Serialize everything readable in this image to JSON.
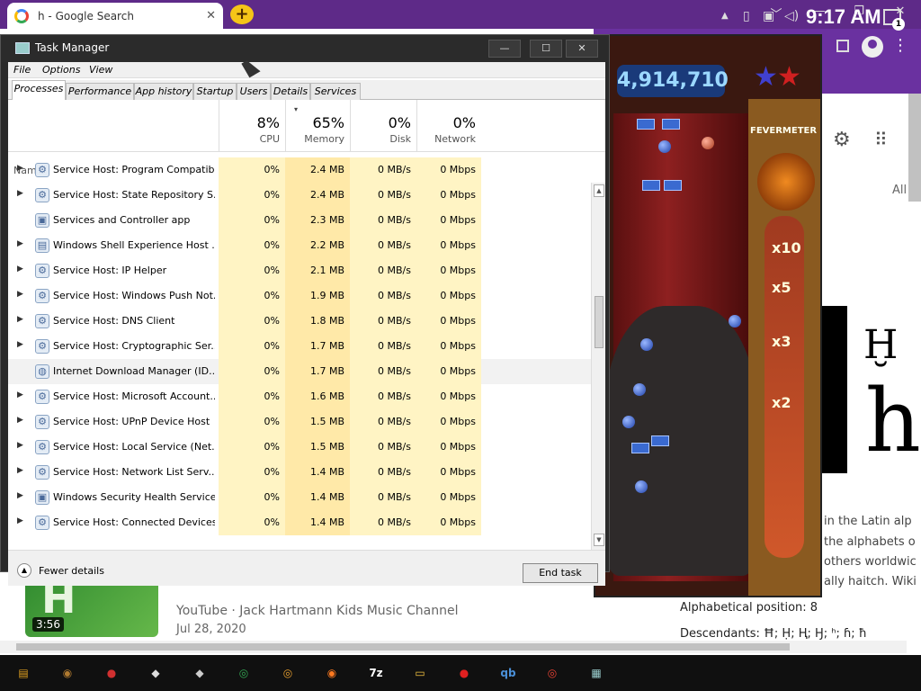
{
  "chrome": {
    "tab_title": "h - Google Search",
    "tab_close": "✕",
    "new_tab": "+",
    "minimize": "﹀",
    "min": "—",
    "restore": "❐",
    "close": "✕",
    "kebab": "⋮",
    "settings_icon": "⚙",
    "apps_icon": "⠿",
    "tab_all": "All",
    "wiki_letter_1": "Ḫ",
    "wiki_letter_2": "h",
    "wiki_lines": [
      "in the Latin alp",
      "the alphabets o",
      "others worldwic",
      "ally haitch. Wiki"
    ],
    "alpha_position": "Alphabetical position: 8",
    "descendants": "Descendants: Ħ; Ḥ; Ⱨ; Ꜧ; ʰ; ɦ; ħ",
    "video_thumb_text": "H",
    "video_duration": "3:56",
    "video_source": "YouTube · Jack Hartmann Kids Music Channel",
    "video_date": "Jul 28, 2020"
  },
  "game": {
    "score": "4,914,710",
    "fever_label": "FEVERMETER",
    "mult_10": "x10",
    "mult_5": "x5",
    "mult_3": "x3",
    "mult_2": "x2"
  },
  "taskmgr": {
    "title": "Task Manager",
    "min": "—",
    "max": "☐",
    "close": "✕",
    "menu": [
      "File",
      "Options",
      "View"
    ],
    "tabs": [
      "Processes",
      "Performance",
      "App history",
      "Startup",
      "Users",
      "Details",
      "Services"
    ],
    "name_header": "Name",
    "columns": [
      {
        "pct": "8%",
        "label": "CPU"
      },
      {
        "pct": "65%",
        "label": "Memory"
      },
      {
        "pct": "0%",
        "label": "Disk"
      },
      {
        "pct": "0%",
        "label": "Network"
      }
    ],
    "sort_arrow": "▾",
    "rows": [
      {
        "name": "Service Host: Program Compatibi...",
        "cpu": "0%",
        "mem": "2.4 MB",
        "disk": "0 MB/s",
        "net": "0 Mbps",
        "expand": true,
        "icon": "gear-icon"
      },
      {
        "name": "Service Host: State Repository S...",
        "cpu": "0%",
        "mem": "2.4 MB",
        "disk": "0 MB/s",
        "net": "0 Mbps",
        "expand": true,
        "icon": "gear-icon"
      },
      {
        "name": "Services and Controller app",
        "cpu": "0%",
        "mem": "2.3 MB",
        "disk": "0 MB/s",
        "net": "0 Mbps",
        "expand": false,
        "icon": "app-icon"
      },
      {
        "name": "Windows Shell Experience Host ...",
        "cpu": "0%",
        "mem": "2.2 MB",
        "disk": "0 MB/s",
        "net": "0 Mbps",
        "expand": true,
        "icon": "window-icon"
      },
      {
        "name": "Service Host: IP Helper",
        "cpu": "0%",
        "mem": "2.1 MB",
        "disk": "0 MB/s",
        "net": "0 Mbps",
        "expand": true,
        "icon": "gear-icon"
      },
      {
        "name": "Service Host: Windows Push Not...",
        "cpu": "0%",
        "mem": "1.9 MB",
        "disk": "0 MB/s",
        "net": "0 Mbps",
        "expand": true,
        "icon": "gear-icon"
      },
      {
        "name": "Service Host: DNS Client",
        "cpu": "0%",
        "mem": "1.8 MB",
        "disk": "0 MB/s",
        "net": "0 Mbps",
        "expand": true,
        "icon": "gear-icon"
      },
      {
        "name": "Service Host: Cryptographic Ser...",
        "cpu": "0%",
        "mem": "1.7 MB",
        "disk": "0 MB/s",
        "net": "0 Mbps",
        "expand": true,
        "icon": "gear-icon"
      },
      {
        "name": "Internet Download Manager (ID...",
        "cpu": "0%",
        "mem": "1.7 MB",
        "disk": "0 MB/s",
        "net": "0 Mbps",
        "expand": false,
        "icon": "globe-icon",
        "selected": true
      },
      {
        "name": "Service Host: Microsoft Account...",
        "cpu": "0%",
        "mem": "1.6 MB",
        "disk": "0 MB/s",
        "net": "0 Mbps",
        "expand": true,
        "icon": "gear-icon"
      },
      {
        "name": "Service Host: UPnP Device Host",
        "cpu": "0%",
        "mem": "1.5 MB",
        "disk": "0 MB/s",
        "net": "0 Mbps",
        "expand": true,
        "icon": "gear-icon"
      },
      {
        "name": "Service Host: Local Service (Net...",
        "cpu": "0%",
        "mem": "1.5 MB",
        "disk": "0 MB/s",
        "net": "0 Mbps",
        "expand": true,
        "icon": "gear-icon"
      },
      {
        "name": "Service Host: Network List Serv...",
        "cpu": "0%",
        "mem": "1.4 MB",
        "disk": "0 MB/s",
        "net": "0 Mbps",
        "expand": true,
        "icon": "gear-icon"
      },
      {
        "name": "Windows Security Health Service",
        "cpu": "0%",
        "mem": "1.4 MB",
        "disk": "0 MB/s",
        "net": "0 Mbps",
        "expand": true,
        "icon": "shield-icon"
      },
      {
        "name": "Service Host: Connected Devices...",
        "cpu": "0%",
        "mem": "1.4 MB",
        "disk": "0 MB/s",
        "net": "0 Mbps",
        "expand": true,
        "icon": "gear-icon"
      }
    ],
    "fewer_details": "Fewer details",
    "end_task": "End task"
  },
  "taskbar": {
    "apps": [
      {
        "name": "winrar-app",
        "glyph": "▤",
        "color": "#e0a020"
      },
      {
        "name": "monkey-game-app",
        "glyph": "◉",
        "color": "#b07a30"
      },
      {
        "name": "red-character-app",
        "glyph": "●",
        "color": "#d03030"
      },
      {
        "name": "peggle-unicorn-app",
        "glyph": "◆",
        "color": "#dddddd"
      },
      {
        "name": "peggle-app-2",
        "glyph": "◆",
        "color": "#cccccc"
      },
      {
        "name": "chrome-app",
        "glyph": "◎",
        "color": "#34a853"
      },
      {
        "name": "chrome-canary-app",
        "glyph": "◎",
        "color": "#e8a030"
      },
      {
        "name": "firefox-app",
        "glyph": "◉",
        "color": "#ff7a20"
      },
      {
        "name": "7zip-app",
        "glyph": "7z",
        "color": "#ffffff"
      },
      {
        "name": "file-explorer-app",
        "glyph": "▭",
        "color": "#f0c040"
      },
      {
        "name": "recorder-app",
        "glyph": "●",
        "color": "#e02020"
      },
      {
        "name": "qbittorrent-app",
        "glyph": "qb",
        "color": "#4a90d9"
      },
      {
        "name": "chrome-app-2",
        "glyph": "◎",
        "color": "#ea4335"
      },
      {
        "name": "task-manager-app",
        "glyph": "▦",
        "color": "#9cc"
      }
    ],
    "tray_up": "▲",
    "clock": "9:17 AM",
    "notifications": "1"
  }
}
